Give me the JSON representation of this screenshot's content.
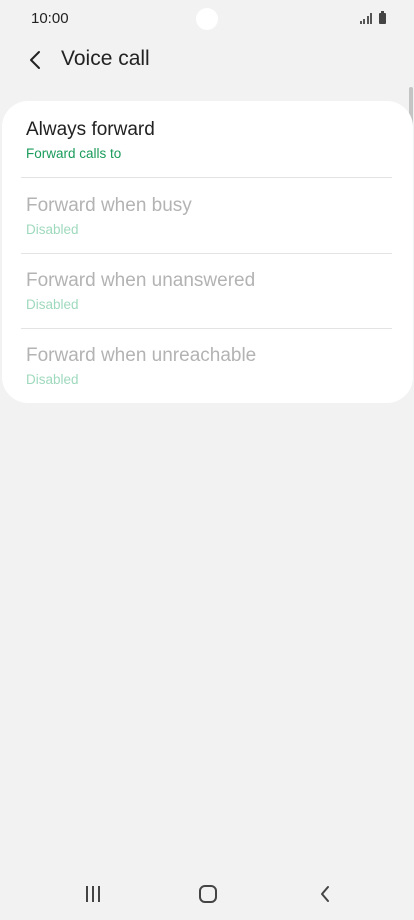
{
  "status_bar": {
    "time": "10:00",
    "icons": [
      "signal-icon",
      "battery-icon"
    ]
  },
  "header": {
    "back_icon": "chevron-left-icon",
    "title": "Voice call"
  },
  "items": [
    {
      "title": "Always forward",
      "subtitle": "Forward calls to",
      "enabled": true
    },
    {
      "title": "Forward when busy",
      "subtitle": "Disabled",
      "enabled": false
    },
    {
      "title": "Forward when unanswered",
      "subtitle": "Disabled",
      "enabled": false
    },
    {
      "title": "Forward when unreachable",
      "subtitle": "Disabled",
      "enabled": false
    }
  ],
  "nav_bar": {
    "icons": [
      "recent-apps-icon",
      "home-icon",
      "back-icon"
    ]
  },
  "colors": {
    "accent": "#1a9b5a",
    "accent_disabled": "#9fd9bd",
    "background": "#f2f2f2",
    "card": "#ffffff"
  }
}
